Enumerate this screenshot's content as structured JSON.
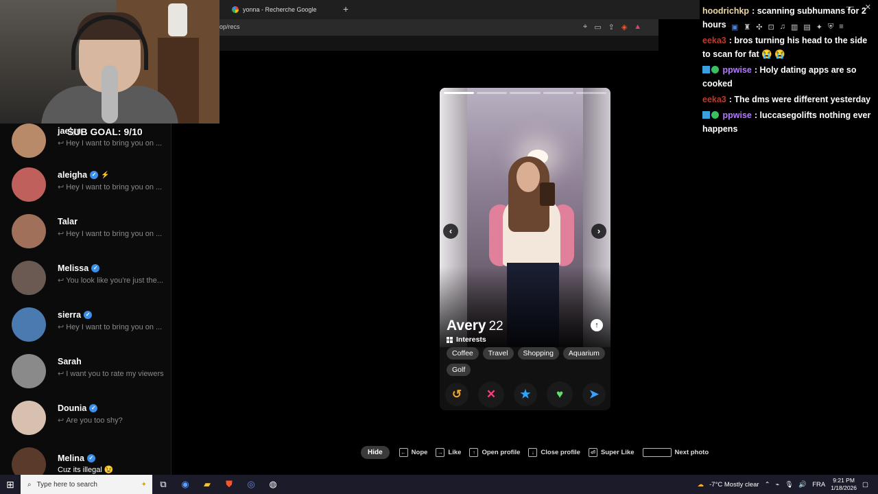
{
  "browser": {
    "tab_title": "yonna - Recherche Google",
    "new_tab": "+",
    "url": "op/recs"
  },
  "chat": {
    "messages": [
      {
        "user": "hoodrichkp",
        "user_color": "#f0d8a0",
        "text": "scanning subhumans for 2 hours"
      },
      {
        "user": "eeka3",
        "user_color": "#c0392b",
        "text": "bros turning his head to the side to scan for fat 😭 😭"
      },
      {
        "user": "ppwise",
        "user_color": "#b57bff",
        "text": "Holy dating apps are so cooked"
      },
      {
        "user": "eeka3",
        "user_color": "#c0392b",
        "text": "The dms were different yesterday"
      },
      {
        "user": "ppwise",
        "user_color": "#b57bff",
        "text": "luccasegolifts nothing ever happens"
      }
    ],
    "separator": ":"
  },
  "overlay": {
    "sub_goal": "SUB GOAL: 9/10"
  },
  "conversations": [
    {
      "name": "jaelyn",
      "verified": false,
      "preview": "Hey I want to bring you on ...",
      "avatar_color": "#b98a6a"
    },
    {
      "name": "aleigha",
      "verified": true,
      "premium": true,
      "preview": "Hey I want to bring you on ...",
      "avatar_color": "#c0605c"
    },
    {
      "name": "Talar",
      "verified": false,
      "preview": "Hey I want to bring you on ...",
      "avatar_color": "#a0705a"
    },
    {
      "name": "Melissa",
      "verified": true,
      "preview": "You look like you're just the...",
      "avatar_color": "#6a5a52"
    },
    {
      "name": "sierra",
      "verified": true,
      "preview": "Hey I want to bring you on ...",
      "avatar_color": "#4a7ab0"
    },
    {
      "name": "Sarah",
      "verified": false,
      "preview": "I want you to rate my viewers",
      "avatar_color": "#8a8a8a"
    },
    {
      "name": "Dounia",
      "verified": true,
      "preview": "Are you too shy?",
      "avatar_color": "#d8c0b0"
    },
    {
      "name": "Melina",
      "verified": true,
      "preview": "Cuz its illegal 😉",
      "avatar_color": "#5a3a2a",
      "no_reply_arrow": true
    }
  ],
  "profile": {
    "name": "Avery",
    "age": "22",
    "interests_label": "Interests",
    "interests": [
      "Coffee",
      "Travel",
      "Shopping",
      "Aquarium",
      "Golf"
    ],
    "photo_count": 5,
    "photo_index": 0
  },
  "actions": [
    {
      "name": "rewind",
      "glyph": "↺",
      "color": "#f5a623"
    },
    {
      "name": "nope",
      "glyph": "✕",
      "color": "#ff3b7f"
    },
    {
      "name": "super-like",
      "glyph": "★",
      "color": "#2aa7ff"
    },
    {
      "name": "like",
      "glyph": "♥",
      "color": "#5ee06a"
    },
    {
      "name": "boost",
      "glyph": "➤",
      "color": "#3aa0ff"
    }
  ],
  "shortcuts": {
    "hide": "Hide",
    "items": [
      {
        "key": "←",
        "label": "Nope"
      },
      {
        "key": "→",
        "label": "Like"
      },
      {
        "key": "↑",
        "label": "Open profile"
      },
      {
        "key": "↓",
        "label": "Close profile"
      },
      {
        "key": "⏎",
        "label": "Super Like"
      },
      {
        "key": "",
        "label": "Next photo",
        "wide": true
      }
    ]
  },
  "taskbar": {
    "search_placeholder": "Type here to search",
    "weather": "-7°C  Mostly clear",
    "lang": "FRA",
    "time": "9:21 PM",
    "date": "1/18/2026"
  }
}
